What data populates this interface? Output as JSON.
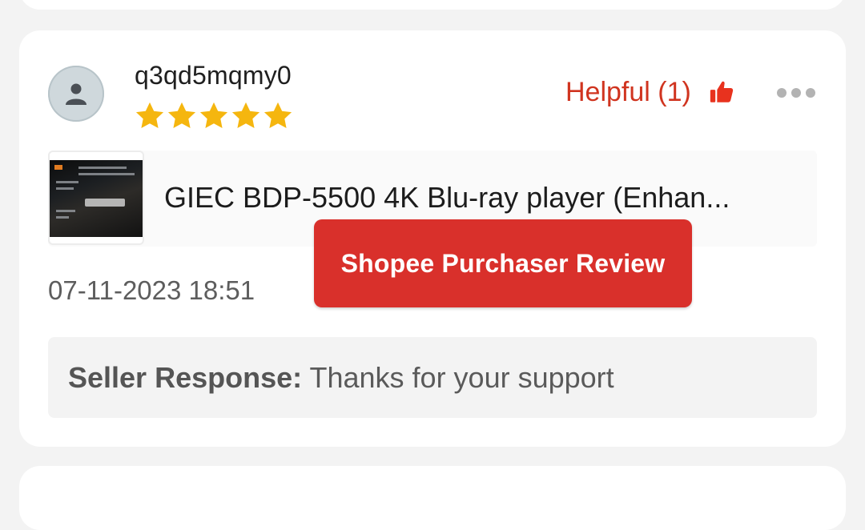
{
  "review": {
    "username": "q3qd5mqmy0",
    "rating": 5,
    "helpful_label": "Helpful (1)",
    "product_title": "GIEC BDP-5500 4K Blu-ray player  (Enhan...",
    "badge_label": "Shopee Purchaser Review",
    "date": "07-11-2023 18:51",
    "seller_response_label": "Seller Response:",
    "seller_response_text": "Thanks for your support"
  },
  "icons": {
    "avatar": "user-icon",
    "star": "star-icon",
    "helpful": "thumbs-up-icon",
    "more": "more-dots-icon"
  },
  "colors": {
    "accent": "#d0341f",
    "badge": "#d9302b",
    "star": "#f5b60f",
    "background": "#f3f3f3"
  }
}
